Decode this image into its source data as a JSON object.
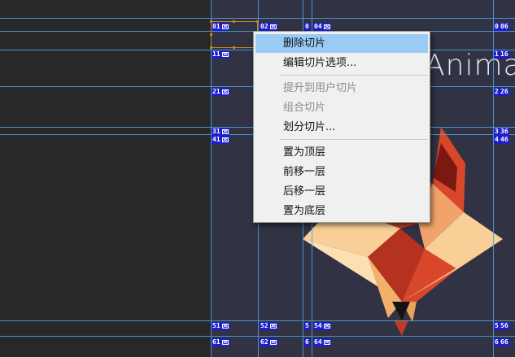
{
  "artboard": {
    "headline": "Anima",
    "colors": {
      "background": "#282828",
      "artboard": "#313244",
      "guide": "#4aa0d8",
      "slice_label": "#1e1ec8",
      "selection": "#c8861e",
      "fox_dark": "#c23a24",
      "fox_light": "#f8cf97"
    }
  },
  "slice_labels": [
    "01",
    "02",
    "0",
    "04",
    "0",
    "06",
    "11",
    "1",
    "16",
    "21",
    "2",
    "26",
    "31",
    "3",
    "36",
    "41",
    "4",
    "46",
    "51",
    "52",
    "5",
    "54",
    "5",
    "56",
    "61",
    "62",
    "6",
    "64",
    "6",
    "66"
  ],
  "context_menu": {
    "items": [
      {
        "label": "删除切片",
        "state": "highlighted"
      },
      {
        "label": "编辑切片选项...",
        "state": "enabled"
      },
      {
        "label": "提升到用户切片",
        "state": "disabled"
      },
      {
        "label": "组合切片",
        "state": "disabled"
      },
      {
        "label": "划分切片...",
        "state": "enabled"
      },
      {
        "label": "置为顶层",
        "state": "enabled"
      },
      {
        "label": "前移一层",
        "state": "enabled"
      },
      {
        "label": "后移一层",
        "state": "enabled"
      },
      {
        "label": "置为底层",
        "state": "enabled"
      }
    ]
  }
}
